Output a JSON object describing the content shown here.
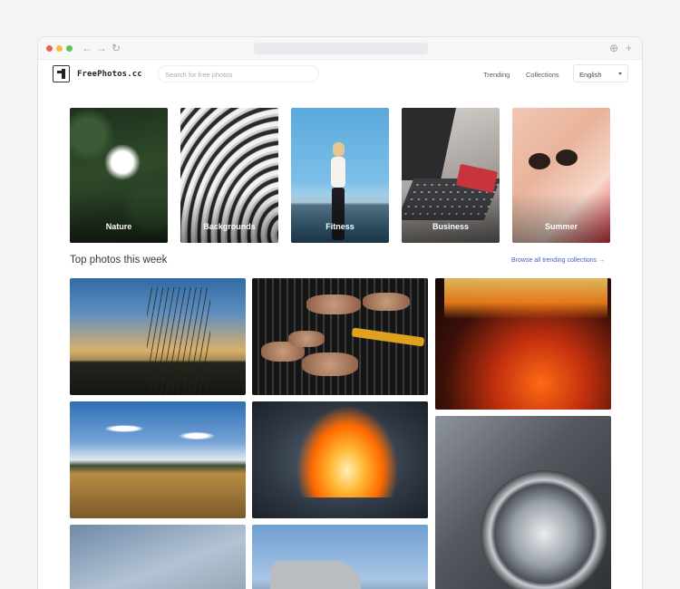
{
  "app": {
    "brand": "FreePhotos.cc"
  },
  "browser": {
    "back_glyph": "←",
    "forward_glyph": "→",
    "reload_glyph": "↻",
    "download_glyph": "⊕",
    "newtab_glyph": "+"
  },
  "search": {
    "placeholder": "Search for free photos",
    "value": ""
  },
  "nav": {
    "trending": "Trending",
    "collections": "Collections",
    "language": "English"
  },
  "categories": [
    {
      "label": "Nature"
    },
    {
      "label": "Backgrounds"
    },
    {
      "label": "Fitness"
    },
    {
      "label": "Business"
    },
    {
      "label": "Summer"
    }
  ],
  "section": {
    "title": "Top photos this week",
    "link": "Browse all trending collections →"
  },
  "icons": [
    "back-arrow-icon",
    "forward-arrow-icon",
    "reload-icon",
    "download-icon",
    "new-tab-icon",
    "chevron-down-icon"
  ],
  "colors": {
    "accent_link": "#4a5bc9",
    "window_bg": "#ffffff",
    "page_bg": "#f3f4f6"
  }
}
